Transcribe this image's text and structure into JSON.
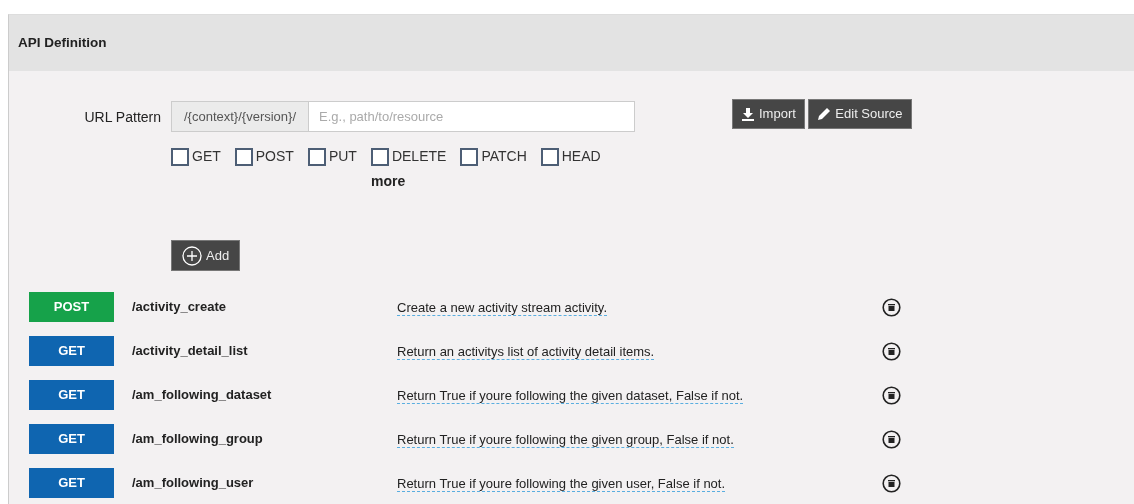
{
  "panel": {
    "title": "API Definition"
  },
  "url_pattern": {
    "label": "URL Pattern",
    "prefix": "/{context}/{version}/",
    "placeholder": "E.g., path/to/resource"
  },
  "buttons": [
    {
      "label": "Import",
      "kind": "import"
    },
    {
      "label": "Edit Source",
      "kind": "edit"
    }
  ],
  "methods": [
    {
      "label": "GET",
      "checked": false
    },
    {
      "label": "POST",
      "checked": false
    },
    {
      "label": "PUT",
      "checked": false
    },
    {
      "label": "DELETE",
      "checked": false
    },
    {
      "label": "PATCH",
      "checked": false
    },
    {
      "label": "HEAD",
      "checked": false
    }
  ],
  "more_link": "more",
  "add_button": "Add",
  "resources": [
    {
      "method": "POST",
      "kind": "post",
      "path": "/activity_create",
      "description": "Create a new activity stream activity."
    },
    {
      "method": "GET",
      "kind": "get",
      "path": "/activity_detail_list",
      "description": "Return an activitys list of activity detail items."
    },
    {
      "method": "GET",
      "kind": "get",
      "path": "/am_following_dataset",
      "description": "Return True if youre following the given dataset, False if not."
    },
    {
      "method": "GET",
      "kind": "get",
      "path": "/am_following_group",
      "description": "Return True if youre following the given group, False if not."
    },
    {
      "method": "GET",
      "kind": "get",
      "path": "/am_following_user",
      "description": "Return True if youre following the given user, False if not."
    }
  ]
}
